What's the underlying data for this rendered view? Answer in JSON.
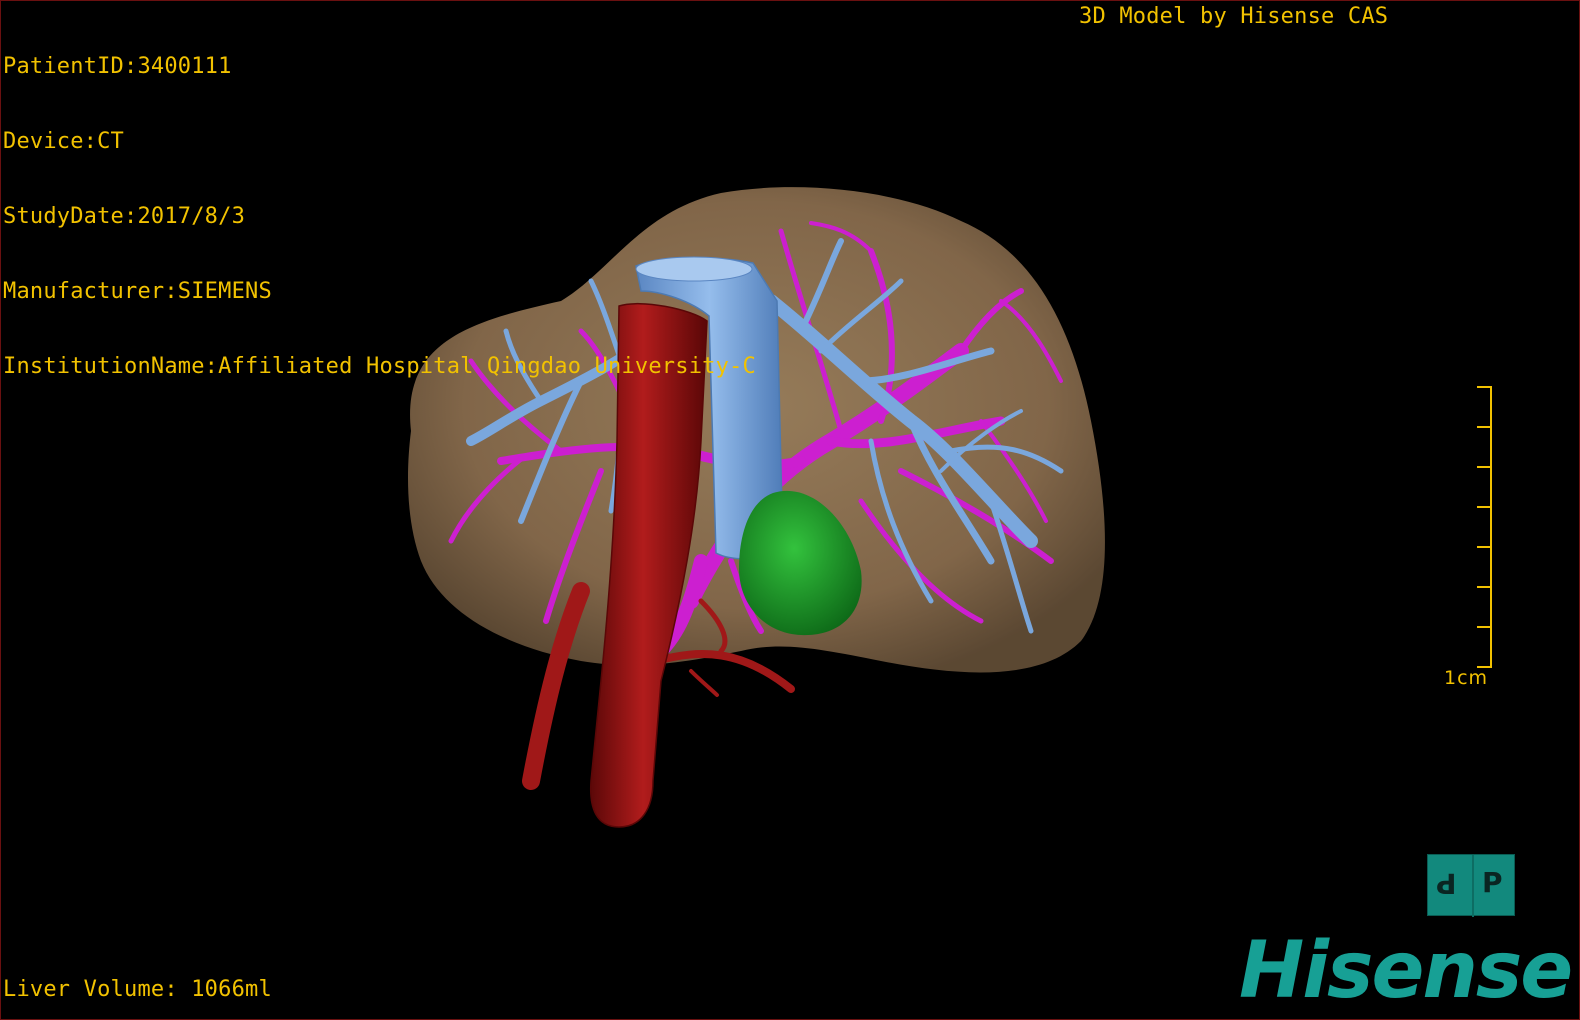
{
  "viewer": {
    "patient_info": {
      "patient_id": "PatientID:3400111",
      "device": "Device:CT",
      "study_date": "StudyDate:2017/8/3",
      "manufacturer": "Manufacturer:SIEMENS",
      "institution": "InstitutionName:Affiliated Hospital Qingdao University-C"
    },
    "title": "3D Model by Hisense CAS",
    "liver_volume": "Liver Volume: 1066ml",
    "scale_label": "1cm",
    "orientation_cube": {
      "left_face": "P",
      "right_face": "P"
    },
    "brand": "Hisense"
  },
  "colors": {
    "overlay_text": "#f2c200",
    "liver_parenchyma": "#8b7152",
    "portal_vein": "#cc1fd0",
    "hepatic_vein": "#7aa7dd",
    "inferior_vena_cava": "#6f9cd8",
    "aorta_artery": "#9a1414",
    "gallbladder": "#1d9a2a",
    "brand_teal": "#17a095",
    "cube_teal": "#12897d"
  },
  "icons": {
    "orientation_cube": "orientation-cube-icon",
    "scale_bar": "scale-bar-icon"
  }
}
